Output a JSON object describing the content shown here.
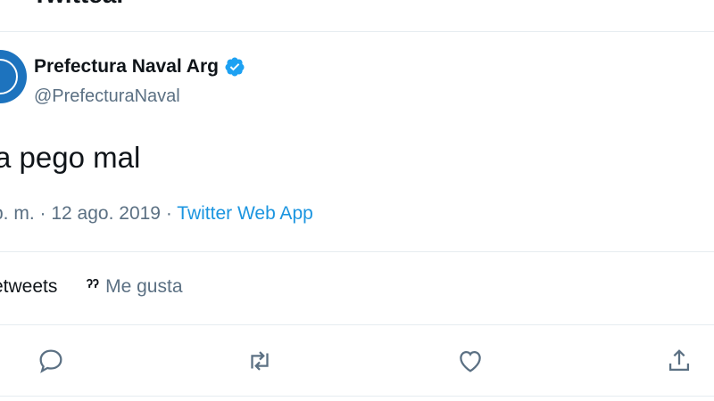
{
  "header": {
    "title": "Twittear"
  },
  "author": {
    "display_name": "Prefectura Naval Arg",
    "handle": "@PrefecturaNaval",
    "verified_icon": "verified-badge-icon",
    "avatar_color": "#1d73be"
  },
  "tweet": {
    "text": "a pego mal",
    "time": "p. m.",
    "separator1": " · ",
    "date": "12 ago. 2019",
    "separator2": " · ",
    "source": "Twitter Web App"
  },
  "stats": {
    "retweets_label": "etweets",
    "likes_count": "ˀˀ",
    "likes_label": "Me gusta"
  },
  "actions": [
    {
      "name": "reply",
      "icon": "reply-icon"
    },
    {
      "name": "retweet",
      "icon": "retweet-icon"
    },
    {
      "name": "like",
      "icon": "heart-icon"
    },
    {
      "name": "share",
      "icon": "share-icon"
    }
  ],
  "colors": {
    "accent": "#1b95e0",
    "muted": "#5b7083",
    "verified": "#1da1f2"
  }
}
